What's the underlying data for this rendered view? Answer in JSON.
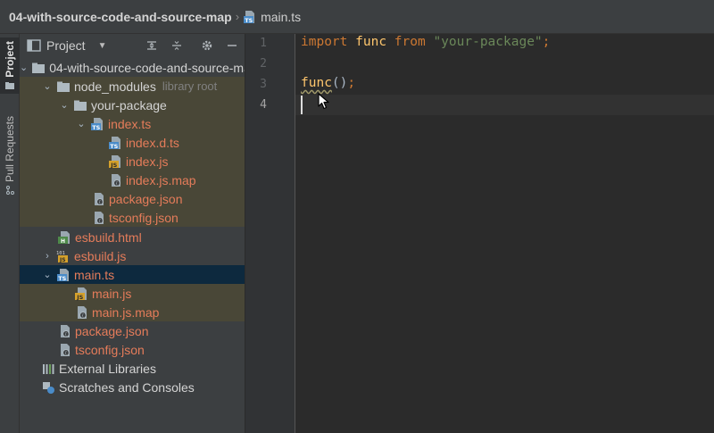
{
  "breadcrumb": {
    "project": "04-with-source-code-and-source-map",
    "separator": "›",
    "file_icon": "typescript-file-icon",
    "file": "main.ts"
  },
  "tool_strip": {
    "project_tab": "Project",
    "pull_requests_tab": "Pull Requests"
  },
  "project_panel": {
    "title": "Project",
    "header_icons": [
      "expand-all-icon",
      "collapse-all-icon",
      "gear-icon",
      "minimize-icon"
    ],
    "tree": [
      {
        "label": "04-with-source-code-and-source-map",
        "icon": "folder-icon",
        "expanded": true
      },
      {
        "label": "node_modules",
        "suffix": "library root",
        "icon": "folder-icon",
        "expanded": true
      },
      {
        "label": "your-package",
        "icon": "folder-icon",
        "expanded": true
      },
      {
        "label": "index.ts",
        "icon": "typescript-file-icon",
        "expanded": true
      },
      {
        "label": "index.d.ts",
        "icon": "typescript-file-icon"
      },
      {
        "label": "index.js",
        "icon": "javascript-file-icon"
      },
      {
        "label": "index.js.map",
        "icon": "source-map-file-icon"
      },
      {
        "label": "package.json",
        "icon": "json-file-icon"
      },
      {
        "label": "tsconfig.json",
        "icon": "json-file-icon"
      },
      {
        "label": "esbuild.html",
        "icon": "html-file-icon"
      },
      {
        "label": "esbuild.js",
        "icon": "binary-js-file-icon",
        "expanded": false
      },
      {
        "label": "main.ts",
        "icon": "typescript-file-icon",
        "expanded": true,
        "selected": true
      },
      {
        "label": "main.js",
        "icon": "javascript-file-icon"
      },
      {
        "label": "main.js.map",
        "icon": "source-map-file-icon"
      },
      {
        "label": "package.json",
        "icon": "json-file-icon"
      },
      {
        "label": "tsconfig.json",
        "icon": "json-file-icon"
      },
      {
        "label": "External Libraries",
        "icon": "libraries-icon"
      },
      {
        "label": "Scratches and Consoles",
        "icon": "scratches-icon"
      }
    ]
  },
  "editor": {
    "line_numbers": [
      "1",
      "2",
      "3",
      "4"
    ],
    "current_line": "4",
    "code": {
      "line1": {
        "kw1": "import",
        "ident": "func",
        "kw2": "from",
        "str": "\"your-package\"",
        "punct": ";"
      },
      "line3": {
        "ident": "func",
        "paren": "()",
        "punct": ";"
      }
    }
  },
  "colors": {
    "editor_bg": "#2b2b2b",
    "panel_bg": "#3c3f41",
    "keyword": "#cc7832",
    "string": "#6a8759",
    "function": "#ffc66d",
    "modified_file": "#e57c5a",
    "selection": "#0d293e"
  }
}
